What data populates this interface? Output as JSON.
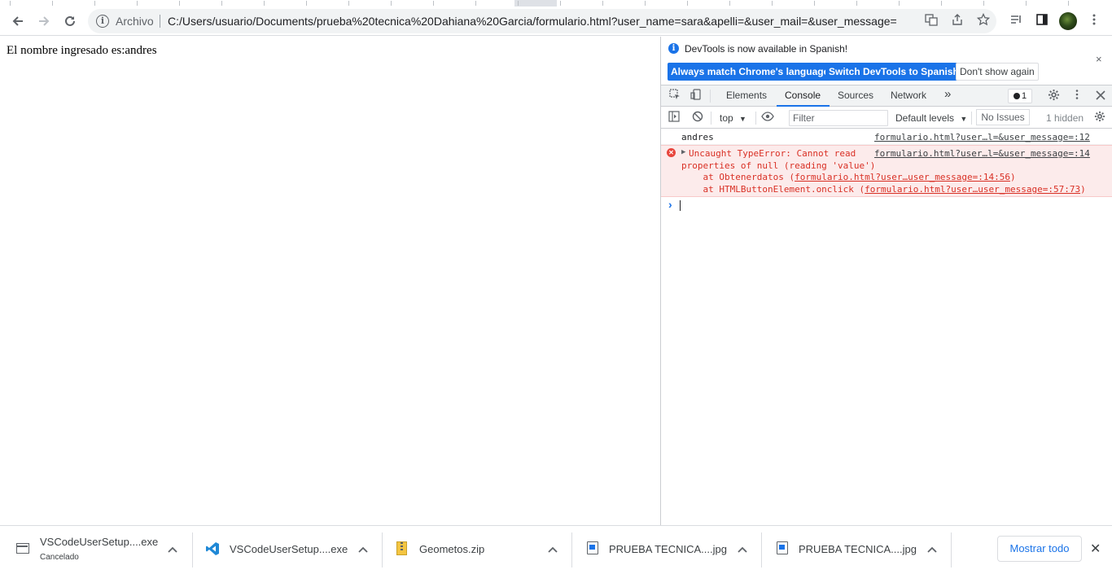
{
  "browser": {
    "address_label": "Archivo",
    "url": "C:/Users/usuario/Documents/prueba%20tecnica%20Dahiana%20Garcia/formulario.html?user_name=sara&apelli=&user_mail=&user_message="
  },
  "page": {
    "text": "El nombre ingresado es:andres"
  },
  "devtools": {
    "infobar": {
      "message": "DevTools is now available in Spanish!",
      "btn_match": "Always match Chrome's language",
      "btn_switch": "Switch DevTools to Spanish",
      "btn_dismiss": "Don't show again",
      "close": "×"
    },
    "tabs": [
      "Elements",
      "Console",
      "Sources",
      "Network"
    ],
    "more_tabs": "»",
    "issues_count": "1",
    "console_toolbar": {
      "context": "top",
      "filter_placeholder": "Filter",
      "levels": "Default levels",
      "issues": "No Issues",
      "hidden": "1 hidden"
    },
    "messages": [
      {
        "text": "andres",
        "source": "formulario.html?user…l=&user_message=:12"
      },
      {
        "text_line1": "Uncaught TypeError: Cannot read",
        "text_line2": "properties of null (reading 'value')",
        "source": "formulario.html?user…l=&user_message=:14",
        "trace1_prefix": "    at Obtenerdatos (",
        "trace1_link": "formulario.html?user…user_message=:14:56",
        "trace2_prefix": "    at HTMLButtonElement.onclick (",
        "trace2_link": "formulario.html?user…user_message=:57:73",
        "trace_suffix": ")"
      }
    ],
    "prompt": "›"
  },
  "downloads": {
    "items": [
      {
        "name": "VSCodeUserSetup....exe",
        "status": "Cancelado",
        "icon": "installer-icon"
      },
      {
        "name": "VSCodeUserSetup....exe",
        "icon": "vscode-icon"
      },
      {
        "name": "Geometos.zip",
        "icon": "zip-icon"
      },
      {
        "name": "PRUEBA TECNICA....jpg",
        "icon": "image-file-icon"
      },
      {
        "name": "PRUEBA TECNICA....jpg",
        "icon": "image-file-icon"
      }
    ],
    "show_all": "Mostrar todo",
    "close": "✕"
  }
}
